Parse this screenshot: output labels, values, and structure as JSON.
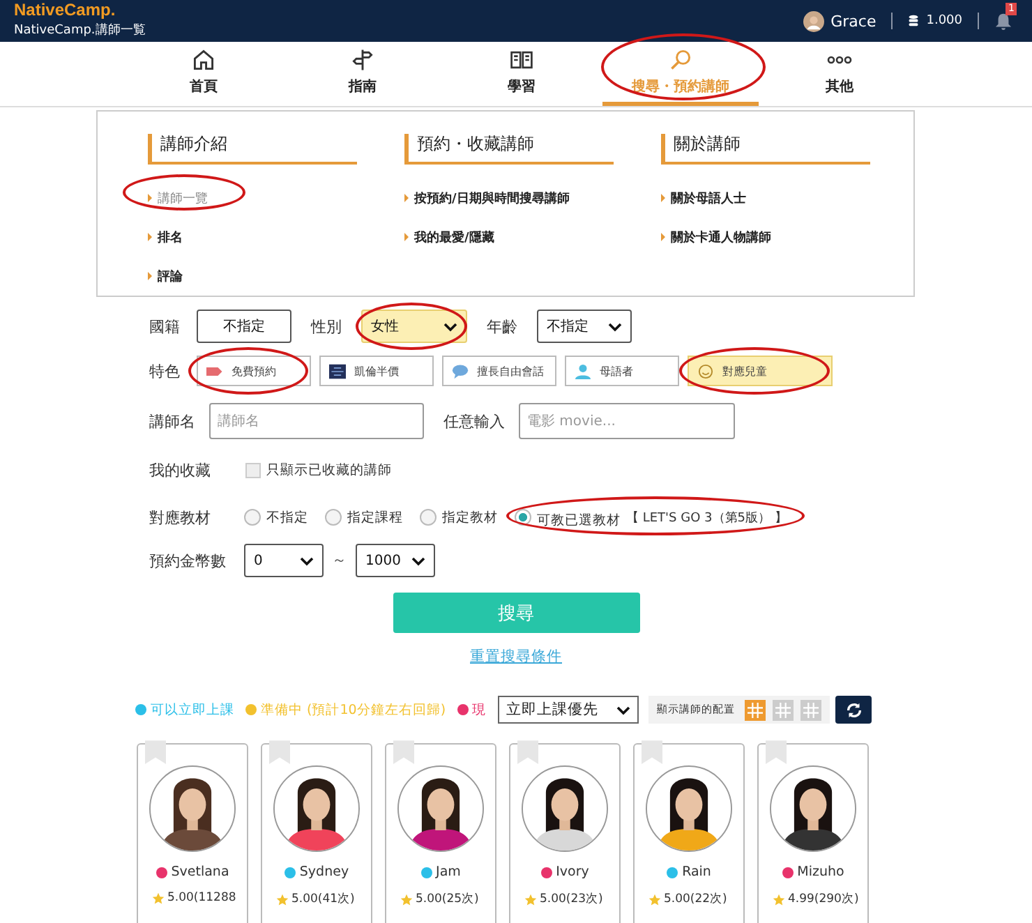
{
  "header": {
    "logo": "NativeCamp.",
    "subtitle": "NativeCamp.講師一覧",
    "user": "Grace",
    "coins": "1.000",
    "badge": "1"
  },
  "nav": [
    {
      "label": "首頁",
      "selected": false,
      "circled": false
    },
    {
      "label": "指南",
      "selected": false,
      "circled": false
    },
    {
      "label": "學習",
      "selected": false,
      "circled": false
    },
    {
      "label": "搜尋・預約講師",
      "selected": true,
      "circled": true
    },
    {
      "label": "其他",
      "selected": false,
      "circled": false
    }
  ],
  "menu": [
    {
      "title": "講師介紹",
      "links": [
        {
          "label": "講師一覽",
          "selected": true,
          "circled": true
        },
        {
          "label": "排名",
          "selected": false,
          "circled": false
        },
        {
          "label": "評論",
          "selected": false,
          "circled": false
        }
      ]
    },
    {
      "title": "預約・收藏講師",
      "links": [
        {
          "label": "按預約/日期與時間搜尋講師",
          "selected": false,
          "circled": false
        },
        {
          "label": "我的最愛/隱藏",
          "selected": false,
          "circled": false
        }
      ]
    },
    {
      "title": "關於講師",
      "links": [
        {
          "label": "關於母語人士",
          "selected": false,
          "circled": false
        },
        {
          "label": "關於卡通人物講師",
          "selected": false,
          "circled": false
        }
      ]
    }
  ],
  "filters": {
    "nationality": {
      "label": "國籍",
      "value": "不指定"
    },
    "gender": {
      "label": "性別",
      "value": "女性",
      "selected": true,
      "circled": true
    },
    "age": {
      "label": "年齡",
      "value": "不指定"
    },
    "features": {
      "label": "特色",
      "options": [
        {
          "label": "免費預約",
          "selected": false,
          "circled": true
        },
        {
          "label": "凱倫半價",
          "selected": false,
          "circled": false
        },
        {
          "label": "擅長自由會話",
          "selected": false,
          "circled": false
        },
        {
          "label": "母語者",
          "selected": false,
          "circled": false
        },
        {
          "label": "對應兒童",
          "selected": true,
          "circled": true
        }
      ]
    },
    "teacher_name": {
      "label": "講師名",
      "placeholder": "講師名"
    },
    "free_input": {
      "label": "任意輸入",
      "placeholder": "電影 movie..."
    },
    "favorites": {
      "label": "我的收藏",
      "option": "只顯示已收藏的講師",
      "checked": false
    },
    "materials": {
      "label": "對應教材",
      "options": [
        {
          "label": "不指定",
          "selected": false,
          "circled": false
        },
        {
          "label": "指定課程",
          "selected": false,
          "circled": false
        },
        {
          "label": "指定教材",
          "selected": false,
          "circled": false
        },
        {
          "label": "可教已選教材",
          "selected": true,
          "circled": true
        }
      ],
      "chosen": "【 LET'S GO 3（第5版） 】"
    },
    "coins": {
      "label": "預約金幣數",
      "from": "0",
      "separator": "～",
      "to": "1000"
    }
  },
  "search_button": "搜尋",
  "reset_link": "重置搜尋條件",
  "legend": [
    {
      "label": "可以立即上課",
      "color": "#2bbfe8"
    },
    {
      "label": "準備中 (預計10分鐘左右回歸)",
      "color": "#f2c12e"
    },
    {
      "label": "現",
      "color": "#e8336b"
    }
  ],
  "sort": "立即上課優先",
  "layout_label": "顯示講師的配置",
  "layouts": [
    {
      "selected": true
    },
    {
      "selected": false
    },
    {
      "selected": false
    }
  ],
  "teachers": [
    {
      "name": "Svetlana",
      "color": "#e8336b",
      "rating": "5.00(11288"
    },
    {
      "name": "Sydney",
      "color": "#2bbfe8",
      "rating": "5.00(41次)"
    },
    {
      "name": "Jam",
      "color": "#2bbfe8",
      "rating": "5.00(25次)"
    },
    {
      "name": "Ivory",
      "color": "#e8336b",
      "rating": "5.00(23次)"
    },
    {
      "name": "Rain",
      "color": "#2bbfe8",
      "rating": "5.00(22次)"
    },
    {
      "name": "Mizuho",
      "color": "#e8336b",
      "rating": "4.99(290次)"
    }
  ]
}
